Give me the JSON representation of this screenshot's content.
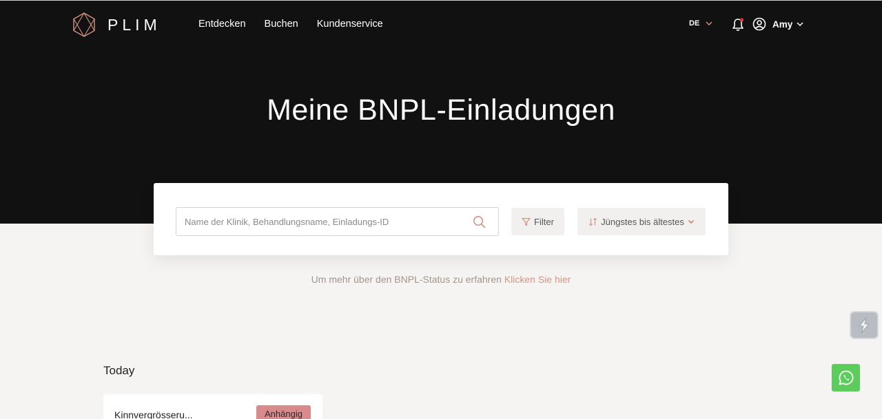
{
  "header": {
    "logo_text": "PLIM",
    "nav": [
      {
        "label": "Entdecken"
      },
      {
        "label": "Buchen"
      },
      {
        "label": "Kundenservice"
      }
    ],
    "language": "DE",
    "user_name": "Amy"
  },
  "hero": {
    "title": "Meine BNPL-Einladungen"
  },
  "search": {
    "placeholder": "Name der Klinik, Behandlungsname, Einladungs-ID",
    "value": "",
    "filter_label": "Filter",
    "sort_label": "Jüngstes bis ältestes"
  },
  "info": {
    "text": "Um mehr über den BNPL-Status zu erfahren",
    "link": "Klicken Sie hier"
  },
  "invitations": {
    "section_title": "Today",
    "items": [
      {
        "title": "Kinnvergrösseru...",
        "status": "Anhängig"
      }
    ]
  },
  "colors": {
    "hero_bg": "#111111",
    "accent": "#d49484",
    "badge": "#d98a8a",
    "whatsapp": "#5ccd5c"
  }
}
